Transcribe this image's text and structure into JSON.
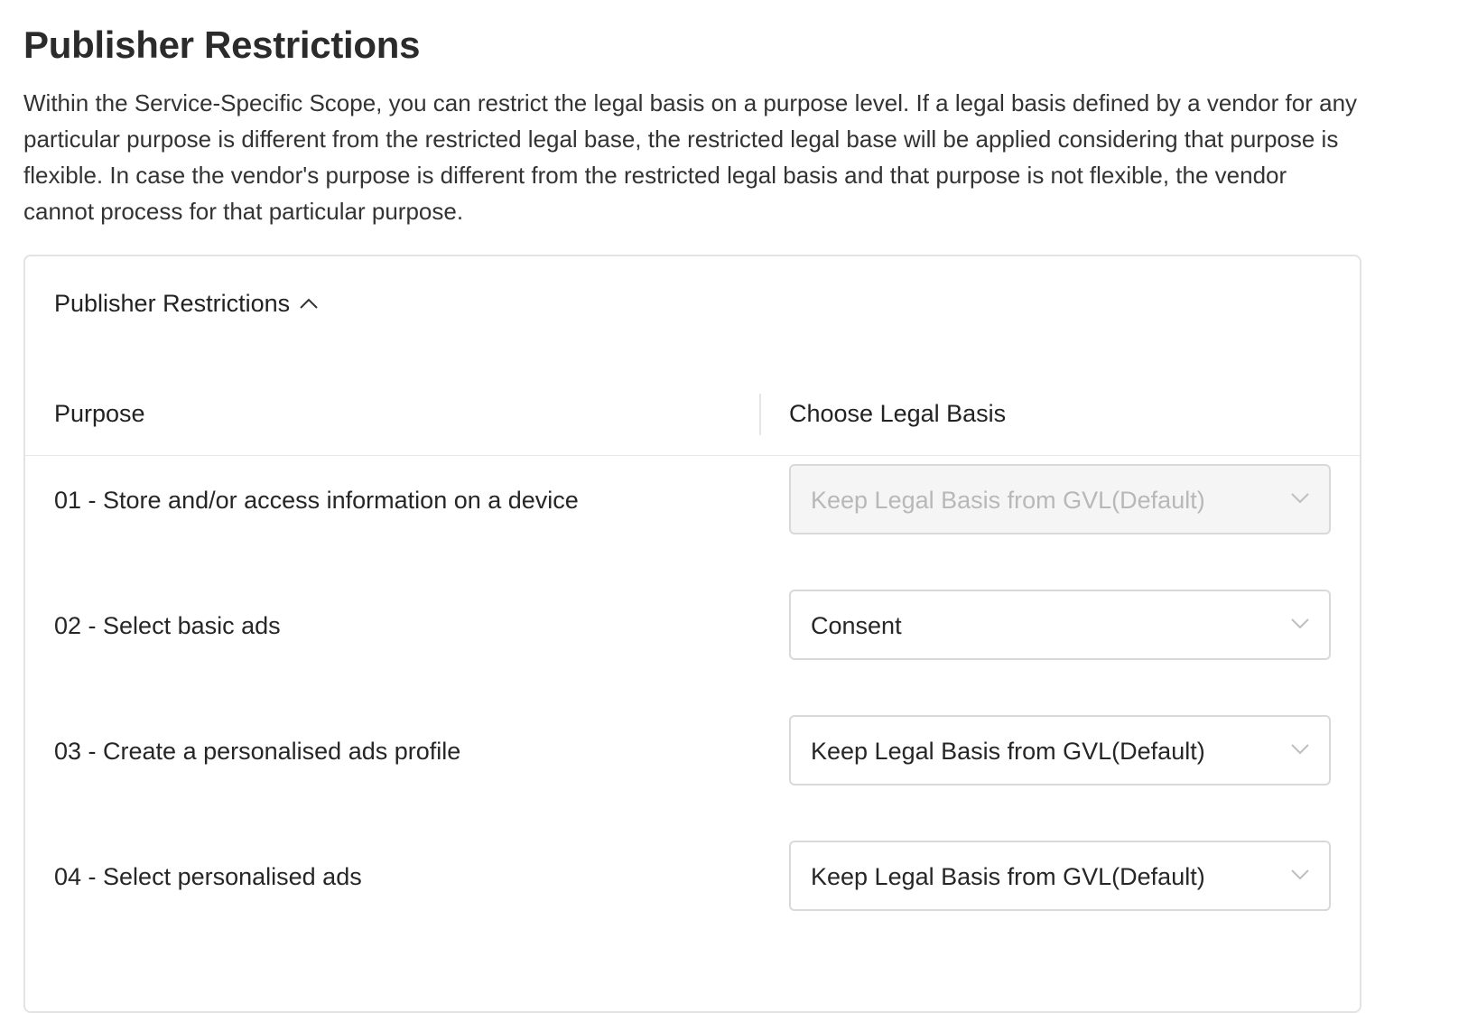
{
  "page": {
    "title": "Publisher Restrictions",
    "description": "Within the Service-Specific Scope, you can restrict the legal basis on a purpose level. If a legal basis defined by a vendor for any particular purpose is different from the restricted legal base, the restricted legal base will be applied considering that purpose is flexible. In case the vendor's purpose is different from the restricted legal basis and that purpose is not flexible, the vendor cannot process for that particular purpose."
  },
  "card": {
    "title": "Publisher Restrictions",
    "expanded": true,
    "icon": "chevron-up-icon"
  },
  "table": {
    "columns": [
      "Purpose",
      "Choose Legal Basis"
    ],
    "rows": [
      {
        "purpose": "01 - Store and/or access information on a device",
        "legal_basis": "Keep Legal Basis from GVL(Default)",
        "disabled": true
      },
      {
        "purpose": "02 - Select basic ads",
        "legal_basis": "Consent",
        "disabled": false
      },
      {
        "purpose": "03 - Create a personalised ads profile",
        "legal_basis": "Keep Legal Basis from GVL(Default)",
        "disabled": false
      },
      {
        "purpose": "04 - Select personalised ads",
        "legal_basis": "Keep Legal Basis from GVL(Default)",
        "disabled": false
      }
    ]
  },
  "colors": {
    "border": "#d9d9d9",
    "disabled_bg": "#f5f5f5",
    "disabled_text": "#b8b8b8",
    "text": "#262626"
  }
}
